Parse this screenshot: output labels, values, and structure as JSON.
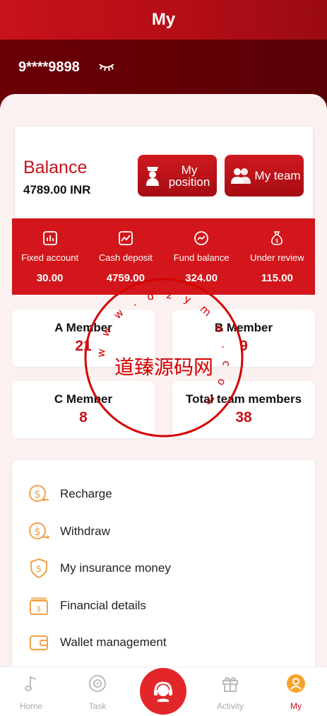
{
  "header": {
    "title": "My"
  },
  "user": {
    "phone_masked": "9****9898",
    "visibility_icon": "eye-closed-icon"
  },
  "balance": {
    "label": "Balance",
    "value": "4789.00 INR",
    "buttons": [
      {
        "label": "My position",
        "icon": "position-icon"
      },
      {
        "label": "My team",
        "icon": "team-icon"
      }
    ]
  },
  "stats": [
    {
      "label": "Fixed account",
      "value": "30.00",
      "icon": "chart-icon"
    },
    {
      "label": "Cash deposit",
      "value": "4759.00",
      "icon": "trend-icon"
    },
    {
      "label": "Fund balance",
      "value": "324.00",
      "icon": "balance-icon"
    },
    {
      "label": "Under review",
      "value": "115.00",
      "icon": "money-bag-icon"
    }
  ],
  "members": [
    {
      "title": "A Member",
      "count": "21"
    },
    {
      "title": "B Member",
      "count": "9"
    },
    {
      "title": "C Member",
      "count": "8"
    },
    {
      "title": "Total team members",
      "count": "38"
    }
  ],
  "menu": [
    {
      "label": "Recharge",
      "icon": "recharge-icon"
    },
    {
      "label": "Withdraw",
      "icon": "withdraw-icon"
    },
    {
      "label": "My insurance money",
      "icon": "insurance-icon"
    },
    {
      "label": "Financial details",
      "icon": "financial-icon"
    },
    {
      "label": "Wallet management",
      "icon": "wallet-icon"
    }
  ],
  "watermark": {
    "text": "道臻源码网",
    "ring_text": "w w w . d z y m w . c o m"
  },
  "nav": [
    {
      "label": "Home",
      "icon": "music-note-icon"
    },
    {
      "label": "Task",
      "icon": "disc-icon"
    },
    {
      "label": "",
      "icon": "support-icon"
    },
    {
      "label": "Activity",
      "icon": "gift-icon"
    },
    {
      "label": "My",
      "icon": "user-icon"
    }
  ],
  "colors": {
    "primary": "#c8121b",
    "dark_band": "#5a0005",
    "panel_bg": "#fbf1f1",
    "icon_orange": "#f0a24a"
  }
}
